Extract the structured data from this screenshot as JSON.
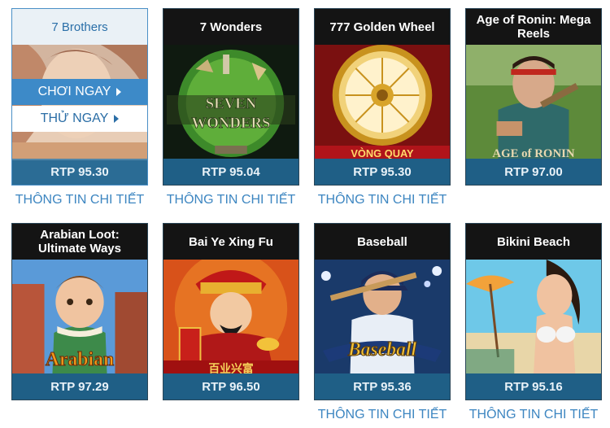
{
  "grid": {
    "row1": [
      {
        "title": "7 Brothers",
        "rtp": "RTP 95.30",
        "info": "THÔNG TIN CHI TIẾT"
      },
      {
        "title": "7 Wonders",
        "rtp": "RTP 95.04",
        "info": "THÔNG TIN CHI TIẾT",
        "art_text": "SEVEN WONDERS"
      },
      {
        "title": "777 Golden Wheel",
        "rtp": "RTP 95.30",
        "info": "THÔNG TIN CHI TIẾT",
        "art_text": "VÒNG QUAY"
      },
      {
        "title": "Age of Ronin: Mega Reels",
        "rtp": "RTP 97.00",
        "art_text": "AGE of RONIN"
      }
    ],
    "row2": [
      {
        "title": "Arabian Loot: Ultimate Ways",
        "rtp": "RTP 97.29",
        "art_text": "Arabian"
      },
      {
        "title": "Bai Ye Xing Fu",
        "rtp": "RTP 96.50",
        "art_text": "百业兴富"
      },
      {
        "title": "Baseball",
        "rtp": "RTP 95.36",
        "info": "THÔNG TIN CHI TIẾT",
        "art_text": "Baseball"
      },
      {
        "title": "Bikini Beach",
        "rtp": "RTP 95.16",
        "info": "THÔNG TIN CHI TIẾT"
      }
    ]
  },
  "hover_actions": {
    "play_label": "CHƠI NGAY",
    "try_label": "THỬ NGAY"
  },
  "colors": {
    "title_bg": "#141414",
    "rtp_bg": "#1f5f86",
    "link": "#3d86c1",
    "play_btn": "#3d8ac8"
  }
}
